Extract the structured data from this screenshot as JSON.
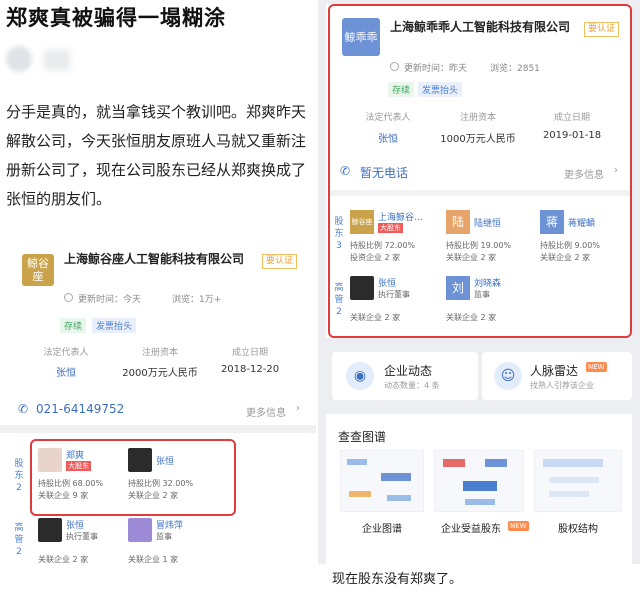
{
  "left": {
    "headline": "郑爽真被骗得一塌糊涂",
    "paragraph": "分手是真的，就当拿钱买个教训吧。郑爽昨天解散公司，今天张恒朋友原班人马就又重新注册新公司了，现在公司股东已经从郑爽换成了张恒的朋友们。",
    "company": {
      "logo_text": "鲸谷座",
      "name": "上海鲸谷座人工智能科技有限公司",
      "badge": "要认证",
      "updated": "更新时间：今天",
      "views": "浏览：1万+",
      "tags": [
        "存续",
        "发票抬头"
      ],
      "labels": [
        "法定代表人",
        "注册资本",
        "成立日期"
      ],
      "values": [
        "张恒",
        "2000万元人民币",
        "2018-12-20"
      ],
      "phone": "021-64149752",
      "more": "更多信息"
    },
    "shareholders": {
      "side_label": "股东",
      "count": "2",
      "items": [
        {
          "name": "郑爽",
          "tag": "大股东",
          "ratio": "持股比例 68.00%",
          "related": "关联企业 9 家"
        },
        {
          "name": "张恒",
          "tag": "",
          "ratio": "持股比例 32.00%",
          "related": "关联企业 2 家"
        }
      ]
    },
    "executives": {
      "side_label": "高管",
      "count": "2",
      "items": [
        {
          "name": "张恒",
          "role": "执行董事",
          "related": "关联企业 2 家"
        },
        {
          "name": "冒炜萍",
          "role": "监事",
          "related": "关联企业 1 家"
        }
      ]
    }
  },
  "right": {
    "company": {
      "logo_text": "鲸乖乖",
      "name": "上海鲸乖乖人工智能科技有限公司",
      "badge": "要认证",
      "updated": "更新时间：昨天",
      "views": "浏览：2851",
      "tags": [
        "存续",
        "发票抬头"
      ],
      "labels": [
        "法定代表人",
        "注册资本",
        "成立日期"
      ],
      "values": [
        "张恒",
        "1000万元人民币",
        "2019-01-18"
      ],
      "phone": "暂无电话",
      "more": "更多信息"
    },
    "shareholders": {
      "side_label": "股东",
      "count": "3",
      "items": [
        {
          "avatar": "鲸谷座",
          "name": "上海鲸谷...",
          "tag": "大股东",
          "ratio": "持股比例 72.00%",
          "related": "投资企业 2 家"
        },
        {
          "avatar": "陆",
          "name": "陆继恒",
          "tag": "",
          "ratio": "持股比例 19.00%",
          "related": "关联企业 2 家"
        },
        {
          "avatar": "蒋",
          "name": "蒋耀頔",
          "tag": "",
          "ratio": "持股比例 9.00%",
          "related": "关联企业 2 家"
        }
      ]
    },
    "executives": {
      "side_label": "高管",
      "count": "2",
      "items": [
        {
          "avatar": "",
          "name": "张恒",
          "role": "执行董事",
          "related": "关联企业 2 家"
        },
        {
          "avatar": "刘",
          "name": "刘晓森",
          "role": "监事",
          "related": "关联企业 2 家"
        }
      ]
    },
    "features": [
      {
        "title": "企业动态",
        "sub": "动态数量：4 条",
        "new": ""
      },
      {
        "title": "人脉雷达",
        "sub": "找熟人引荐该企业",
        "new": "NEW"
      }
    ],
    "graph_section": {
      "title": "查查图谱",
      "items": [
        {
          "label": "企业图谱",
          "new": ""
        },
        {
          "label": "企业受益股东",
          "new": "NEW"
        },
        {
          "label": "股权结构",
          "new": ""
        }
      ]
    },
    "caption": "现在股东没有郑爽了。"
  },
  "colors": {
    "red_box": "#e23b3b",
    "link_blue": "#3c6fc0",
    "badge_orange": "#e9a23b",
    "tag_green": "#3fa35a"
  }
}
